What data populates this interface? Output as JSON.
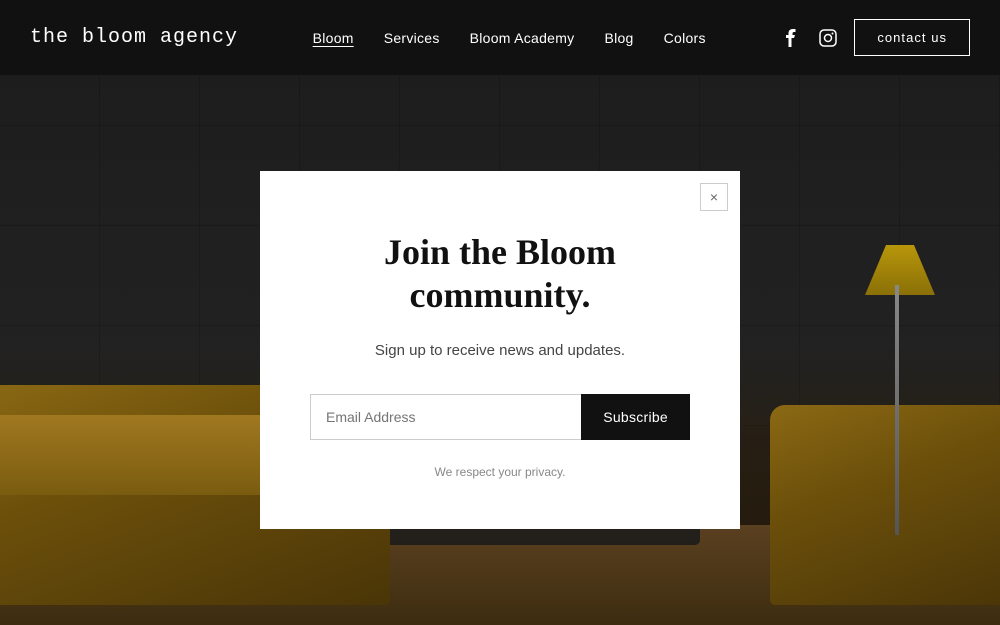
{
  "site": {
    "logo": "the bloom agency"
  },
  "nav": {
    "items": [
      {
        "label": "Bloom",
        "active": true
      },
      {
        "label": "Services",
        "active": false
      },
      {
        "label": "Bloom Academy",
        "active": false
      },
      {
        "label": "Blog",
        "active": false
      },
      {
        "label": "Colors",
        "active": false
      }
    ],
    "contact_label": "contact us"
  },
  "social": {
    "facebook_icon": "f",
    "instagram_icon": "◻"
  },
  "modal": {
    "title": "Join the Bloom community.",
    "subtitle": "Sign up to receive news and updates.",
    "email_placeholder": "Email Address",
    "subscribe_label": "Subscribe",
    "privacy_text": "We respect your privacy.",
    "close_label": "×"
  }
}
